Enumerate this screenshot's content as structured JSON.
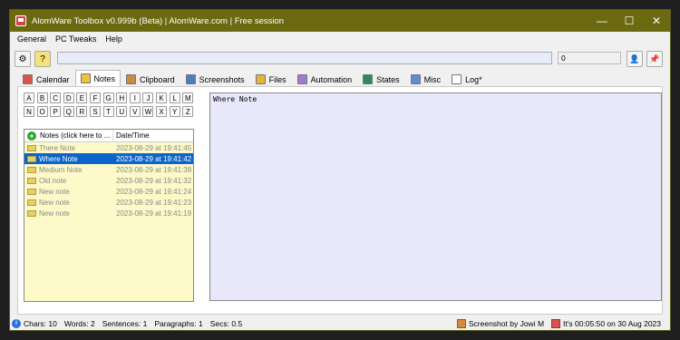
{
  "window": {
    "title": "AlomWare Toolbox v0.999b (Beta)  |  AlomWare.com  |  Free session",
    "minimize": "—",
    "maximize": "☐",
    "close": "✕"
  },
  "menu": [
    {
      "label": "General"
    },
    {
      "label": "PC Tweaks"
    },
    {
      "label": "Help"
    }
  ],
  "toolbar": {
    "settings_glyph": "⚙",
    "help_glyph": "?",
    "number_value": "0",
    "user_glyph": "👤",
    "pin_glyph": "📌"
  },
  "tabs": [
    {
      "label": "Calendar",
      "icon": "calendar-icon",
      "color": "#d9534f"
    },
    {
      "label": "Notes",
      "icon": "notes-icon",
      "color": "#f0c23a",
      "active": true
    },
    {
      "label": "Clipboard",
      "icon": "clipboard-icon",
      "color": "#c98b3f"
    },
    {
      "label": "Screenshots",
      "icon": "screenshots-icon",
      "color": "#4a7fbf"
    },
    {
      "label": "Files",
      "icon": "files-icon",
      "color": "#e3b340"
    },
    {
      "label": "Automation",
      "icon": "automation-icon",
      "color": "#a07bd0"
    },
    {
      "label": "States",
      "icon": "states-icon",
      "color": "#2e8b57"
    },
    {
      "label": "Misc",
      "icon": "misc-icon",
      "color": "#5a8fd6"
    },
    {
      "label": "Log*",
      "icon": "log-icon",
      "color": "#9aa7b8"
    }
  ],
  "letters_row1": [
    "A",
    "B",
    "C",
    "D",
    "E",
    "F",
    "G",
    "H",
    "I",
    "J",
    "K",
    "L",
    "M"
  ],
  "letters_row2": [
    "N",
    "O",
    "P",
    "Q",
    "R",
    "S",
    "T",
    "U",
    "V",
    "W",
    "X",
    "Y",
    "Z"
  ],
  "notes_list": {
    "col_notes": "Notes  (click here to ...",
    "col_date": "Date/Time",
    "add_glyph": "+",
    "rows": [
      {
        "name": "There Note",
        "date": "2023-08-29 at 19:41:45"
      },
      {
        "name": "Where Note",
        "date": "2023-08-29 at 19:41:42",
        "selected": true
      },
      {
        "name": "Medium Note",
        "date": "2023-08-29 at 19:41:38"
      },
      {
        "name": "Old note",
        "date": "2023-08-29 at 19:41:32"
      },
      {
        "name": "New note",
        "date": "2023-08-29 at 19:41:24"
      },
      {
        "name": "New note",
        "date": "2023-08-29 at 19:41:23"
      },
      {
        "name": "New note",
        "date": "2023-08-29 at 19:41:19"
      }
    ]
  },
  "editor": {
    "text": "Where Note"
  },
  "status": {
    "info_glyph": "i",
    "chars": "Chars: 10",
    "words": "Words: 2",
    "sentences": "Sentences: 1",
    "paragraphs": "Paragraphs: 1",
    "secs": "Secs: 0.5",
    "screenshot_by": "Screenshot by Jowi M",
    "time": "It's 00:05:50 on 30 Aug 2023"
  }
}
